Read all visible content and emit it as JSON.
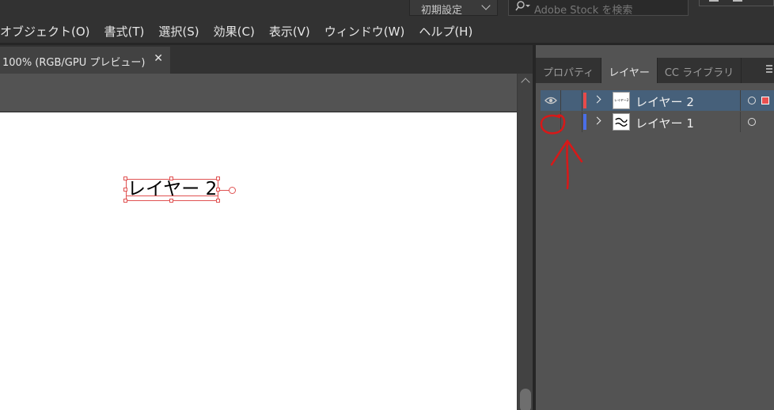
{
  "topbar": {
    "workspace_label": "初期設定",
    "stock_placeholder": "Adobe Stock を検索"
  },
  "menubar": {
    "items": [
      "オブジェクト(O)",
      "書式(T)",
      "選択(S)",
      "効果(C)",
      "表示(V)",
      "ウィンドウ(W)",
      "ヘルプ(H)"
    ]
  },
  "document": {
    "tab_label": "100% (RGB/GPU プレビュー)",
    "close_glyph": "✕",
    "selected_text": "レイヤー 2"
  },
  "panel": {
    "tabs": [
      "プロパティ",
      "レイヤー",
      "CC ライブラリ"
    ],
    "active_tab": "レイヤー",
    "layers": [
      {
        "name": "レイヤー 2",
        "color": "#e84a4a",
        "visible": true,
        "selected": true,
        "thumb_text": "レイヤー2"
      },
      {
        "name": "レイヤー 1",
        "color": "#4a6ee8",
        "visible": false,
        "selected": false
      }
    ]
  },
  "colors": {
    "selection": "#e05252",
    "layer_selected_bg": "#46607a",
    "annotation": "#d81818"
  }
}
